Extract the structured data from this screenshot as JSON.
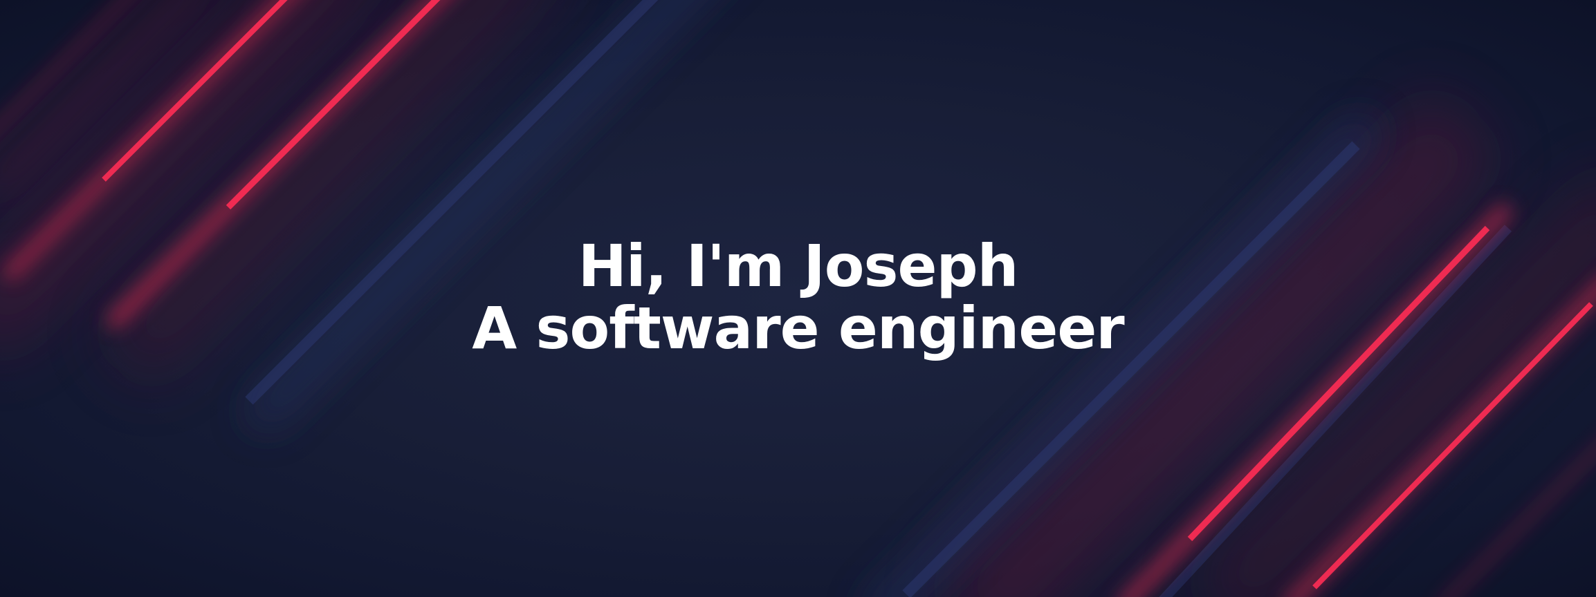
{
  "hero": {
    "greeting": "Hi, I'm Joseph",
    "role": "A software engineer"
  },
  "colors": {
    "background": "#161c33",
    "accent_red": "#ff2d55",
    "accent_blue": "#2a3566",
    "text": "#ffffff"
  }
}
